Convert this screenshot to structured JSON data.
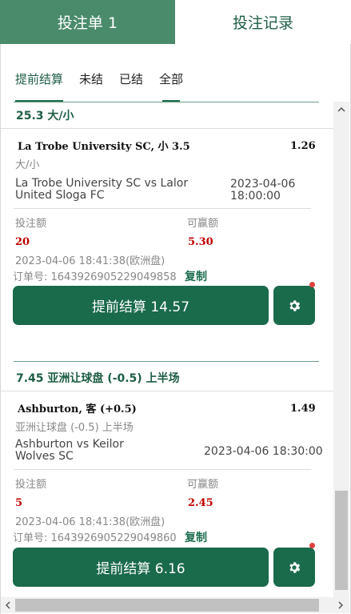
{
  "header": {
    "tabs": [
      {
        "label": "投注单 1",
        "active": true
      },
      {
        "label": "投注记录",
        "active": false
      }
    ]
  },
  "filters": [
    {
      "label": "提前结算",
      "selected": true
    },
    {
      "label": "未结",
      "selected": false
    },
    {
      "label": "已结",
      "selected": false
    },
    {
      "label": "全部",
      "selected": false
    }
  ],
  "bets": [
    {
      "title": "25.3 大/小",
      "selection": "La Trobe University SC, 小 3.5",
      "odds": "1.26",
      "market": "大/小",
      "match_line1": "La Trobe University SC vs Lalor",
      "match_line2": "United Sloga FC",
      "kickoff_line1": "2023-04-06",
      "kickoff_line2": "18:00:00",
      "stake_label": "投注额",
      "stake": "20",
      "win_label": "可赢额",
      "win": "5.30",
      "placed": "2023-04-06 18:41:38(欧洲盘)",
      "order": "订单号: 1643926905229049858",
      "copy_label": "复制",
      "cashout_label": "提前结算 14.57"
    },
    {
      "title": "7.45 亚洲让球盘 (-0.5) 上半场",
      "selection": "Ashburton, 客 (+0.5)",
      "odds": "1.49",
      "market": "亚洲让球盘 (-0.5) 上半场",
      "match_line1": "Ashburton vs Keilor",
      "match_line2": "Wolves SC",
      "kickoff": "2023-04-06 18:30:00",
      "stake_label": "投注额",
      "stake": "5",
      "win_label": "可赢额",
      "win": "2.45",
      "placed": "2023-04-06 18:41:38(欧洲盘)",
      "order": "订单号: 1643926905229049860",
      "copy_label": "复制",
      "cashout_label": "提前结算 6.16"
    }
  ],
  "colors": {
    "primary": "#1a6a4c",
    "tab_active": "#4a8b6b",
    "accent_text": "#1e5e45",
    "red": "#c00000"
  },
  "icons": {
    "settings": "gear-icon",
    "notify": "red-dot"
  }
}
